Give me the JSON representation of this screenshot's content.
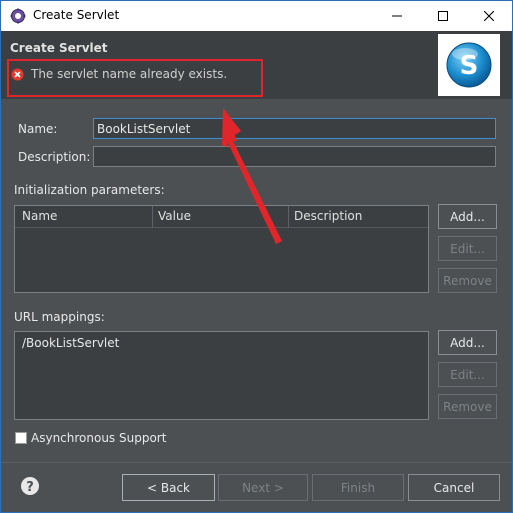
{
  "window": {
    "title": "Create Servlet"
  },
  "header": {
    "title": "Create Servlet",
    "message": "The servlet name already exists.",
    "banner_letter": "S"
  },
  "form": {
    "name_label": "Name:",
    "name_value": "BookListServlet",
    "description_label": "Description:",
    "description_value": ""
  },
  "init_params": {
    "label": "Initialization parameters:",
    "columns": [
      "Name",
      "Value",
      "Description"
    ],
    "add_label": "Add...",
    "edit_label": "Edit...",
    "remove_label": "Remove"
  },
  "url_mappings": {
    "label": "URL mappings:",
    "items": [
      "/BookListServlet"
    ],
    "add_label": "Add...",
    "edit_label": "Edit...",
    "remove_label": "Remove"
  },
  "async": {
    "label": "Asynchronous Support",
    "checked": false
  },
  "footer": {
    "back_label": "< Back",
    "next_label": "Next >",
    "finish_label": "Finish",
    "cancel_label": "Cancel"
  },
  "colors": {
    "accent": "#3d8fd1",
    "error": "#e0262a",
    "dialog_bg": "#4c5052",
    "header_bg": "#3c3f41"
  }
}
